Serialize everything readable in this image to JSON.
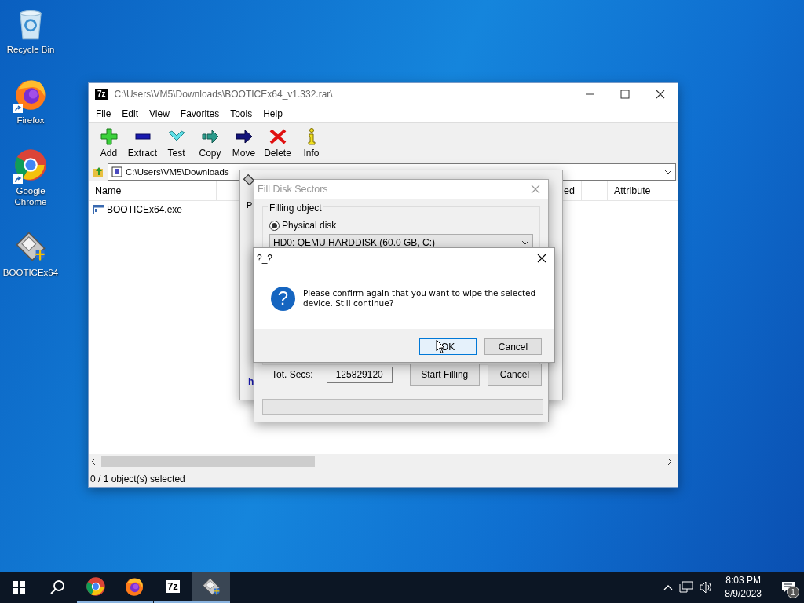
{
  "desktop_icons": [
    {
      "label": "Recycle Bin",
      "kind": "recycle",
      "shortcut": false
    },
    {
      "label": "Firefox",
      "kind": "firefox",
      "shortcut": true
    },
    {
      "label": "Google Chrome",
      "kind": "chrome",
      "shortcut": true
    },
    {
      "label": "BOOTICEx64",
      "kind": "bootice",
      "shortcut": false
    }
  ],
  "archive_window": {
    "logo": "7z",
    "title": "C:\\Users\\VM5\\Downloads\\BOOTICEx64_v1.332.rar\\",
    "menu": [
      "File",
      "Edit",
      "View",
      "Favorites",
      "Tools",
      "Help"
    ],
    "toolbar": [
      {
        "label": "Add",
        "kind": "add"
      },
      {
        "label": "Extract",
        "kind": "extract"
      },
      {
        "label": "Test",
        "kind": "test"
      },
      {
        "label": "Copy",
        "kind": "copy"
      },
      {
        "label": "Move",
        "kind": "move"
      },
      {
        "label": "Delete",
        "kind": "delete"
      },
      {
        "label": "Info",
        "kind": "info"
      }
    ],
    "address": "C:\\Users\\VM5\\Downloads",
    "columns": [
      {
        "label": "Name"
      },
      {
        "label": "ed"
      },
      {
        "label": "Attribute"
      }
    ],
    "rows": [
      {
        "name": "BOOTICEx64.exe"
      }
    ],
    "status": "0 / 1 object(s) selected"
  },
  "bootice_window": {
    "tab": "P",
    "link": "h"
  },
  "fill_dialog": {
    "title": "Fill Disk Sectors",
    "group": "Filling object",
    "radio": {
      "label": "Physical disk",
      "selected": true
    },
    "device": "HD0: QEMU HARDDISK (60.0 GB, C:)",
    "total_label": "Tot. Secs:",
    "total_value": "125829120",
    "buttons": [
      "Start Filling",
      "Cancel"
    ]
  },
  "confirm_dialog": {
    "title": "?_?",
    "icon_glyph": "?",
    "message": "Please confirm again that you want to wipe the selected device. Still continue?",
    "buttons": [
      {
        "label": "OK",
        "focused": true
      },
      {
        "label": "Cancel",
        "focused": false
      }
    ]
  },
  "taskbar": {
    "apps": [
      {
        "kind": "chrome",
        "active": false
      },
      {
        "kind": "firefox",
        "active": false
      },
      {
        "kind": "sevenzip",
        "label": "7z",
        "active": false
      },
      {
        "kind": "bootice",
        "active": true
      }
    ],
    "time": "8:03 PM",
    "date": "8/9/2023",
    "notifications": "1"
  }
}
